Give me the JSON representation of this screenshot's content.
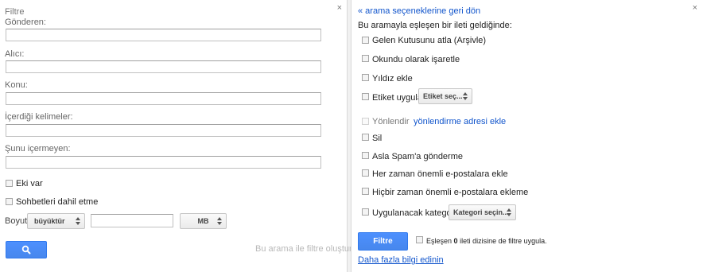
{
  "left": {
    "title": "Filtre",
    "close_glyph": "×",
    "fields": [
      {
        "label": "Gönderen:",
        "value": ""
      },
      {
        "label": "Alıcı:",
        "value": ""
      },
      {
        "label": "Konu:",
        "value": ""
      },
      {
        "label": "İçerdiği kelimeler:",
        "value": ""
      },
      {
        "label": "Şunu içermeyen:",
        "value": ""
      }
    ],
    "has_attachment": "Eki var",
    "include_chats": "Sohbetleri dahil etme",
    "size_label": "Boyut",
    "size_operator": "büyüktür",
    "size_value": "",
    "size_unit": "MB",
    "search_icon": "magnifier-icon",
    "create_filter_link": "Bu arama ile filtre oluştur »"
  },
  "right": {
    "back_link": "« arama seçeneklerine geri dön",
    "close_glyph": "×",
    "heading": "Bu aramayla eşleşen bir ileti geldiğinde:",
    "options": [
      "Gelen Kutusunu atla (Arşivle)",
      "Okundu olarak işaretle",
      "Yıldız ekle",
      "Etiket uygula:",
      "Yönlendir",
      "Sil",
      "Asla Spam'a gönderme",
      "Her zaman önemli e-postalara ekle",
      "Hiçbir zaman önemli e-postalara ekleme",
      "Uygulanacak kategori:"
    ],
    "label_select": "Etiket seç...",
    "forward_link": "yönlendirme adresi ekle",
    "category_select": "Kategori seçin...",
    "create_filter_button": "Filtre oluştur",
    "apply_prefix": "Eşleşen",
    "apply_count": "0",
    "apply_suffix": "ileti dizisine de filtre uygula.",
    "learn_more": "Daha fazla bilgi edinin"
  },
  "colors": {
    "accent": "#4d90fe",
    "link": "#1155cc"
  }
}
